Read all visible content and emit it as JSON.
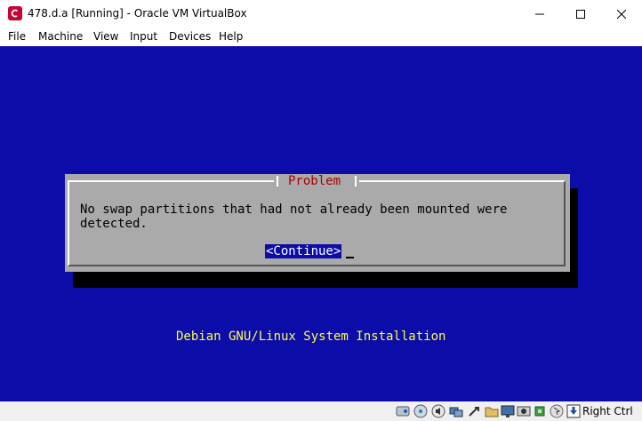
{
  "window": {
    "title": "478.d.a [Running] - Oracle VM VirtualBox",
    "app_icon": "debian-swirl-icon",
    "controls": [
      "minimize-icon",
      "maximize-icon",
      "close-icon"
    ]
  },
  "menubar": {
    "items": [
      "File",
      "Machine",
      "View",
      "Input",
      "Devices",
      "Help"
    ]
  },
  "vm_screen": {
    "background": "#0c0ca8",
    "dialog": {
      "title": "Problem",
      "message": "No swap partitions that had not already been mounted were\ndetected.",
      "button": "<Continue>"
    },
    "footer": "Debian GNU/Linux System Installation"
  },
  "statusbar": {
    "icons": [
      "hard-disk-icon",
      "optical-drive-icon",
      "audio-icon",
      "network-icon",
      "usb-icon",
      "shared-folders-icon",
      "display-icon",
      "video-capture-icon",
      "cpu-icon",
      "mouse-integration-icon",
      "host-key-arrow-icon"
    ],
    "host_key": "Right Ctrl"
  }
}
